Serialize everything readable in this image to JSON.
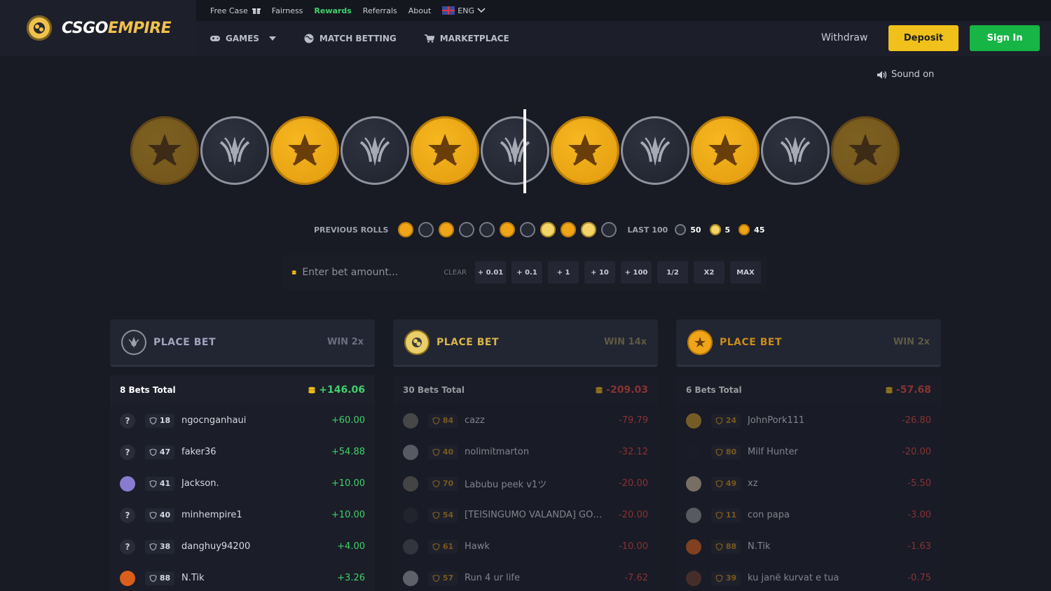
{
  "brand": {
    "name_a": "CSGO",
    "name_b": "EMPIRE"
  },
  "topbar": {
    "free_case": "Free Case",
    "fairness": "Fairness",
    "rewards": "Rewards",
    "referrals": "Referrals",
    "about": "About",
    "lang": "ENG"
  },
  "nav": {
    "games": "GAMES",
    "match_betting": "MATCH BETTING",
    "marketplace": "MARKETPLACE"
  },
  "actions": {
    "withdraw": "Withdraw",
    "deposit": "Deposit",
    "signin": "Sign In"
  },
  "sound": "Sound on",
  "roulette": [
    "t",
    "ct",
    "t",
    "ct",
    "t",
    "ct",
    "t",
    "ct",
    "t",
    "ct",
    "t"
  ],
  "previous_rolls": {
    "label": "PREVIOUS ROLLS",
    "rolls": [
      "t",
      "ct",
      "t",
      "ct",
      "ct",
      "t",
      "ct",
      "bonus",
      "t",
      "bonus",
      "ct"
    ],
    "last100_label": "LAST 100",
    "ct_count": "50",
    "bonus_count": "5",
    "t_count": "45"
  },
  "bet": {
    "placeholder": "Enter bet amount...",
    "clear": "CLEAR",
    "buttons": [
      "+ 0.01",
      "+ 0.1",
      "+ 1",
      "+ 10",
      "+ 100",
      "1/2",
      "X2",
      "MAX"
    ]
  },
  "columns": [
    {
      "title": "PLACE BET",
      "win": "WIN 2x",
      "total_label": "8 Bets Total",
      "total_amount": "+146.06",
      "rows": [
        {
          "avatar": "?",
          "level": "18",
          "name": "ngocnganhaui",
          "amount": "+60.00"
        },
        {
          "avatar": "?",
          "level": "47",
          "name": "faker36",
          "amount": "+54.88"
        },
        {
          "avatar": "",
          "level": "41",
          "name": "Jackson.",
          "amount": "+10.00"
        },
        {
          "avatar": "?",
          "level": "40",
          "name": "minhempire1",
          "amount": "+10.00"
        },
        {
          "avatar": "?",
          "level": "38",
          "name": "danghuy94200",
          "amount": "+4.00"
        },
        {
          "avatar": "",
          "level": "88",
          "name": "N.Tik",
          "amount": "+3.26"
        }
      ]
    },
    {
      "title": "PLACE BET",
      "win": "WIN 14x",
      "total_label": "30 Bets Total",
      "total_amount": "-209.03",
      "rows": [
        {
          "avatar": "",
          "level": "84",
          "name": "cazz",
          "amount": "-79.79"
        },
        {
          "avatar": "",
          "level": "40",
          "name": "nolimitmarton",
          "amount": "-32.12"
        },
        {
          "avatar": "",
          "level": "70",
          "name": "Labubu peek v1ツ",
          "amount": "-20.00"
        },
        {
          "avatar": "",
          "level": "54",
          "name": "[TEISINGUMO VALANDA] GOD...",
          "amount": "-20.00"
        },
        {
          "avatar": "",
          "level": "61",
          "name": "Hawk",
          "amount": "-10.00"
        },
        {
          "avatar": "",
          "level": "57",
          "name": "Run 4 ur life",
          "amount": "-7.62"
        }
      ]
    },
    {
      "title": "PLACE BET",
      "win": "WIN 2x",
      "total_label": "6 Bets Total",
      "total_amount": "-57.68",
      "rows": [
        {
          "avatar": "",
          "level": "24",
          "name": "JohnPork111",
          "amount": "-26.80"
        },
        {
          "avatar": "",
          "level": "80",
          "name": "Milf Hunter",
          "amount": "-20.00"
        },
        {
          "avatar": "",
          "level": "49",
          "name": "xz",
          "amount": "-5.50"
        },
        {
          "avatar": "",
          "level": "11",
          "name": "con papa",
          "amount": "-3.00"
        },
        {
          "avatar": "",
          "level": "88",
          "name": "N.Tik",
          "amount": "-1.63"
        },
        {
          "avatar": "",
          "level": "39",
          "name": "ku janë kurvat e tua",
          "amount": "-0.75"
        }
      ]
    }
  ],
  "colors": {
    "accent_yellow": "#f0c11b",
    "accent_green": "#16b545",
    "positive": "#3fd16a",
    "negative": "#e0483e",
    "t_coin": "#f0a418",
    "ct_coin": "#262a35"
  }
}
